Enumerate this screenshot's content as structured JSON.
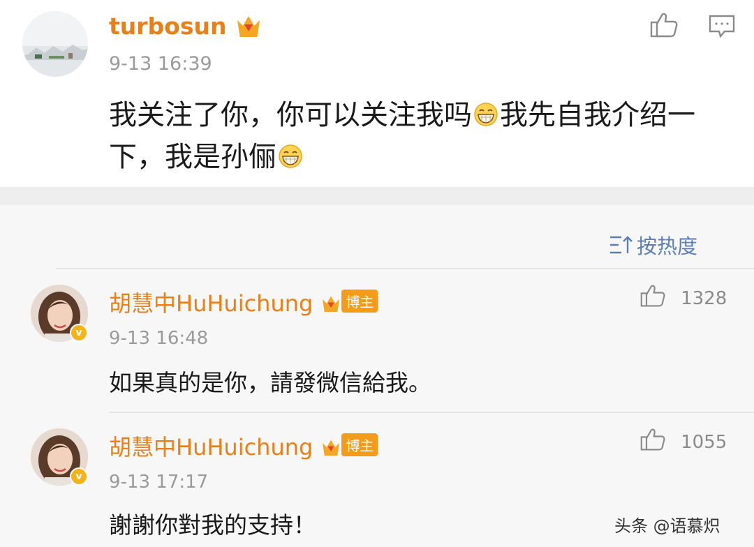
{
  "post": {
    "username": "turbosun",
    "time": "9-13 16:39",
    "text_line1": "我关注了你，你可以关注我吗",
    "text_line1b": "我先自我介绍一",
    "text_line2": "下，我是孙俪"
  },
  "sort": {
    "label": "按热度"
  },
  "comments": [
    {
      "username": "胡慧中HuHuichung",
      "badge": "博主",
      "time": "9-13 16:48",
      "text": "如果真的是你，請發微信給我。",
      "likes": "1328"
    },
    {
      "username": "胡慧中HuHuichung",
      "badge": "博主",
      "time": "9-13 17:17",
      "text": "謝謝你對我的支持！",
      "likes": "1055"
    }
  ],
  "watermark": "头条 @语慕炽",
  "colors": {
    "username": "#e8801a",
    "sort_accent": "#5b7fb5",
    "badge": "#f49b1a"
  }
}
